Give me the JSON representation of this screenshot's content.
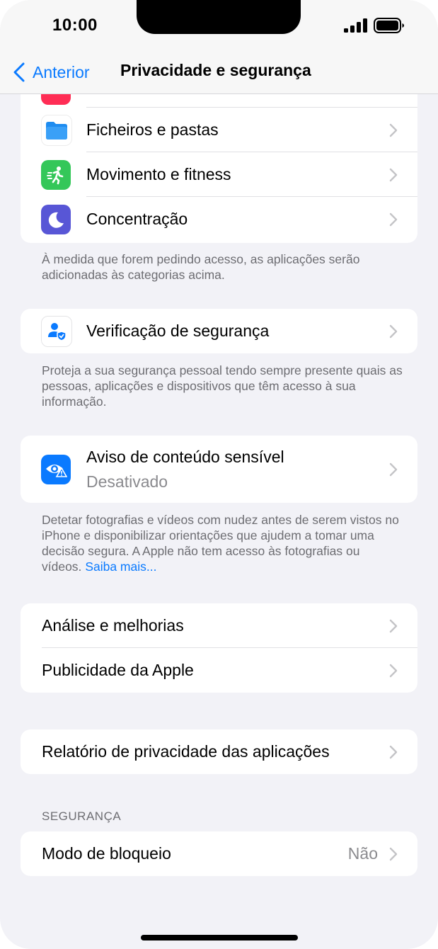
{
  "status_bar": {
    "time": "10:00"
  },
  "nav": {
    "back_label": "Anterior",
    "title": "Privacidade e segurança"
  },
  "apps_group": {
    "items": [
      {
        "label": "Ficheiros e pastas",
        "icon": "folder-icon",
        "color": "#1e8cf0"
      },
      {
        "label": "Movimento e fitness",
        "icon": "running-figure-icon",
        "color": "#34c759"
      },
      {
        "label": "Concentração",
        "icon": "moon-icon",
        "color": "#5856d6"
      }
    ],
    "footer": "À medida que forem pedindo acesso, as aplicações serão adicionadas às categorias acima."
  },
  "safety_check": {
    "label": "Verificação de segurança",
    "icon": "person-shield-icon",
    "footer": "Proteja a sua segurança pessoal tendo sempre presente quais as pessoas, aplicações e dispositivos que têm acesso à sua informação."
  },
  "sensitive_content": {
    "label": "Aviso de conteúdo sensível",
    "value": "Desativado",
    "icon": "eye-warning-icon",
    "footer": "Detetar fotografias e vídeos com nudez antes de serem vistos no iPhone e disponibilizar orientações que ajudem a tomar uma decisão segura. A Apple não tem acesso às fotografias ou vídeos.",
    "footer_link": "Saiba mais..."
  },
  "analytics_group": {
    "items": [
      {
        "label": "Análise e melhorias"
      },
      {
        "label": "Publicidade da Apple"
      }
    ]
  },
  "app_privacy_report": {
    "label": "Relatório de privacidade das aplicações"
  },
  "security_section": {
    "header": "SEGURANÇA",
    "lockdown": {
      "label": "Modo de bloqueio",
      "value": "Não"
    }
  },
  "colors": {
    "accent": "#0a7aff",
    "background": "#f2f2f7"
  }
}
